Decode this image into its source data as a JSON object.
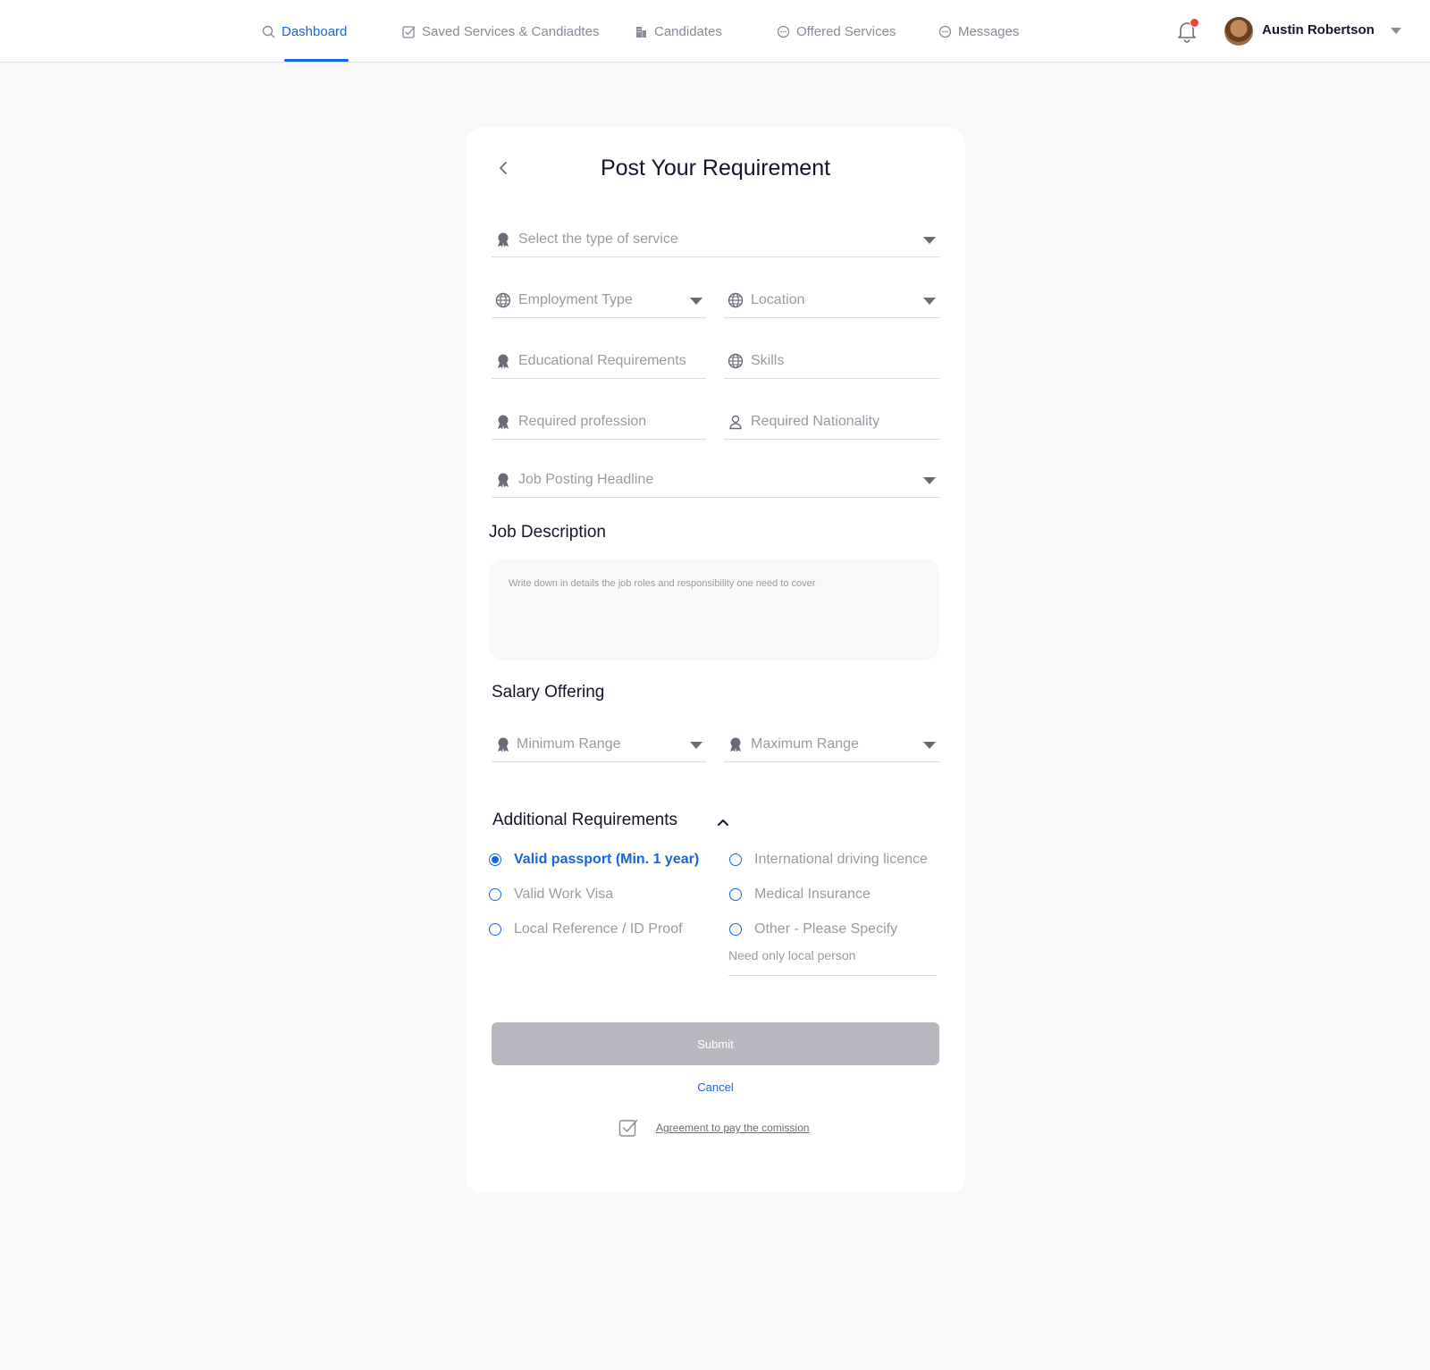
{
  "nav": {
    "items": [
      {
        "label": "Dashboard",
        "icon": "search-icon",
        "active": true
      },
      {
        "label": "Saved Services & Candiadtes",
        "icon": "checkbox-icon"
      },
      {
        "label": "Candidates",
        "icon": "building-icon"
      },
      {
        "label": "Offered Services",
        "icon": "chat-bubble-icon"
      },
      {
        "label": "Messages",
        "icon": "chat-bubble-icon"
      }
    ],
    "user_name": "Austin Robertson",
    "has_notification": true,
    "accent_color": "#1565e8",
    "notification_color": "#f0433a"
  },
  "form": {
    "title": "Post Your Requirement",
    "service_type": {
      "placeholder": "Select the type of service",
      "icon": "award-icon"
    },
    "employment_type": {
      "placeholder": "Employment Type",
      "icon": "globe-icon"
    },
    "location": {
      "placeholder": "Location",
      "icon": "globe-icon"
    },
    "education": {
      "placeholder": "Educational Requirements",
      "icon": "award-icon"
    },
    "skills": {
      "placeholder": "Skills",
      "icon": "globe-icon"
    },
    "profession": {
      "placeholder": "Required profession",
      "icon": "award-icon"
    },
    "nationality": {
      "placeholder": "Required Nationality",
      "icon": "user-icon"
    },
    "headline": {
      "placeholder": "Job Posting Headline",
      "icon": "award-icon"
    },
    "job_description": {
      "title": "Job Description",
      "placeholder": "Write down in details the job roles and responsibility one need to cover"
    },
    "salary": {
      "title": "Salary Offering",
      "min": {
        "placeholder": "Minimum Range",
        "icon": "award-icon"
      },
      "max": {
        "placeholder": "Maximum Range",
        "icon": "award-icon"
      }
    },
    "additional": {
      "title": "Additional Requirements",
      "options": [
        {
          "label": "Valid passport (Min. 1 year)",
          "selected": true
        },
        {
          "label": "International driving licence",
          "selected": false
        },
        {
          "label": "Valid Work Visa",
          "selected": false
        },
        {
          "label": "Medical Insurance",
          "selected": false
        },
        {
          "label": "Local Reference / ID Proof",
          "selected": false
        },
        {
          "label": "Other - Please Specify",
          "selected": false
        }
      ],
      "other_value": "Need only local person"
    },
    "submit_label": "Submit",
    "cancel_label": "Cancel",
    "agreement_label": "Agreement to pay the comission"
  }
}
